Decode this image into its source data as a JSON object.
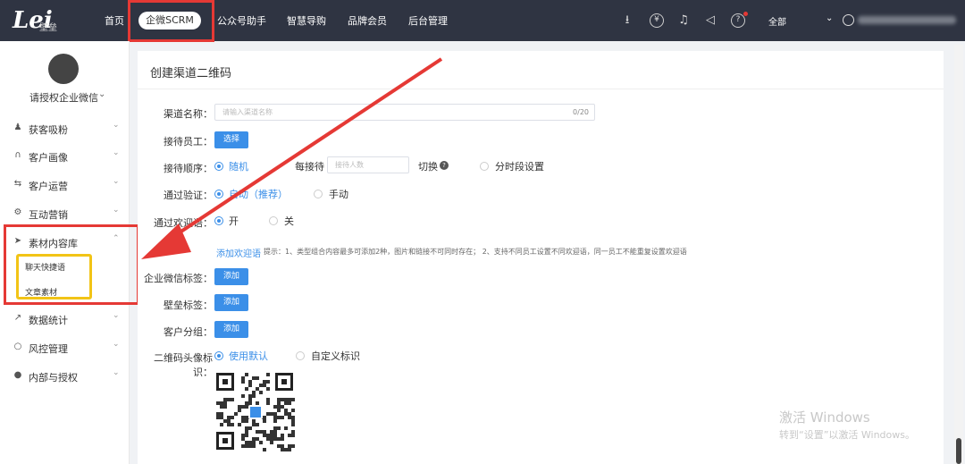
{
  "topbar": {
    "logo_mark": "Lei",
    "logo_text": "壁垒",
    "nav": [
      "首页",
      "企微SCRM",
      "公众号助手",
      "智慧导购",
      "品牌会员",
      "后台管理"
    ],
    "active_nav": "企微SCRM",
    "icons": [
      "download-icon",
      "yen-icon",
      "headset-icon",
      "speaker-icon",
      "help-icon"
    ],
    "scope": "全部",
    "colors": {
      "bar": "#2f3442",
      "highlight": "#e53935"
    }
  },
  "sidebar": {
    "org_label": "请授权企业微信",
    "items": [
      {
        "label": "获客吸粉",
        "icon": "person-icon"
      },
      {
        "label": "客户画像",
        "icon": "headphone-icon"
      },
      {
        "label": "客户运营",
        "icon": "refresh-icon"
      },
      {
        "label": "互动营销",
        "icon": "gears-icon"
      },
      {
        "label": "素材内容库",
        "icon": "send-icon"
      },
      {
        "label": "数据统计",
        "icon": "chart-icon"
      },
      {
        "label": "风控管理",
        "icon": "chat-icon"
      },
      {
        "label": "内部与授权",
        "icon": "wechat-icon"
      }
    ],
    "sub_items": [
      "聊天快捷语",
      "文章素材"
    ]
  },
  "panel": {
    "title": "创建渠道二维码",
    "channel_name_label": "渠道名称：",
    "channel_name_placeholder": "请输入渠道名称",
    "channel_name_counter": "0/20",
    "staff_label": "接待员工：",
    "select_button": "选择",
    "order_label": "接待顺序：",
    "order_random": "随机",
    "order_each": "每接待",
    "order_each_placeholder": "接待人数",
    "order_switch": "切换",
    "order_time": "分时段设置",
    "verify_label": "通过验证：",
    "verify_auto": "自动（推荐）",
    "verify_manual": "手动",
    "welcome_label": "通过欢迎语：",
    "welcome_on": "开",
    "welcome_off": "关",
    "add_welcome": "添加欢迎语",
    "welcome_hint": "提示：1、类型组合内容最多可添加2种，图片和链接不可同时存在； 2、支持不同员工设置不同欢迎语，同一员工不能重复设置欢迎语",
    "tag_label": "企业微信标签：",
    "bilei_tag_label": "壁垒标签：",
    "group_label": "客户分组：",
    "add_button": "添加",
    "avatar_label": "二维码头像标识：",
    "avatar_default": "使用默认",
    "avatar_custom": "自定义标识"
  },
  "watermark": {
    "line1": "激活 Windows",
    "line2": "转到“设置”以激活 Windows。"
  }
}
